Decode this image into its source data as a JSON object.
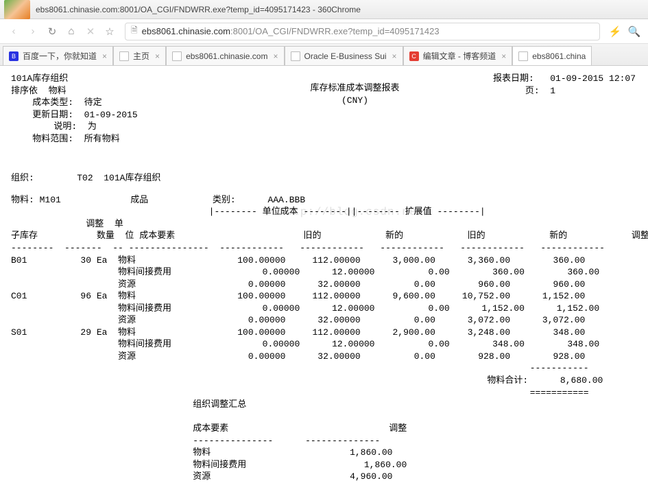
{
  "window": {
    "title": "ebs8061.chinasie.com:8001/OA_CGI/FNDWRR.exe?temp_id=4095171423 - 360Chrome"
  },
  "url": {
    "scheme_host": "ebs8061.chinasie.com",
    "port_path": ":8001/OA_CGI/FNDWRR.exe?temp_id=4095171423"
  },
  "tabs": [
    {
      "label": "百度一下，你就知道",
      "favicon": "baidu"
    },
    {
      "label": "主页",
      "favicon": "page"
    },
    {
      "label": "ebs8061.chinasie.com",
      "favicon": "page"
    },
    {
      "label": "Oracle E-Business Sui",
      "favicon": "page"
    },
    {
      "label": "编辑文章 - 博客频道",
      "favicon": "csdn"
    },
    {
      "label": "ebs8061.china",
      "favicon": "page",
      "active": true
    }
  ],
  "report": {
    "org_header": "101A库存组织",
    "sort_label": "排序依",
    "sort_value": "物料",
    "cost_type_label": "成本类型:",
    "cost_type_value": "待定",
    "update_date_label": "更新日期:",
    "update_date_value": "01-09-2015",
    "desc_label": "说明:",
    "desc_value": "为",
    "item_range_label": "物料范围:",
    "item_range_value": "所有物料",
    "title1": "库存标准成本调整报表",
    "title2": "(CNY)",
    "report_date_label": "报表日期:",
    "report_date_value": "01-09-2015 12:07",
    "page_label": "页:",
    "page_value": "1",
    "org_label": "组织:",
    "org_value": "T02  101A库存组织",
    "item_label": "物料:",
    "item_value": "M101",
    "item_desc": "成品",
    "cat_label": "类别:",
    "cat_value": "AAA.BBB",
    "watermark": "http://blog.csdn.net/",
    "hdr_adj": "调整",
    "hdr_sub": "子库存",
    "hdr_qty": "数量",
    "hdr_uom": "单\n位",
    "hdr_cost_element": "成本要素",
    "hdr_unit_cost": "单位成本",
    "hdr_ext_value": "扩展值",
    "hdr_old": "旧的",
    "hdr_new": "新的",
    "hdr_adj2": "调整",
    "total_label": "物料合计:",
    "total_value": "8,680.00",
    "rows": [
      {
        "sub": "B01",
        "qty": "30",
        "uom": "Ea",
        "elem": "物料",
        "uc_old": "100.00000",
        "uc_new": "112.00000",
        "ev_old": "3,000.00",
        "ev_new": "3,360.00",
        "adj": "360.00"
      },
      {
        "sub": "",
        "qty": "",
        "uom": "",
        "elem": "物料间接费用",
        "uc_old": "0.00000",
        "uc_new": "12.00000",
        "ev_old": "0.00",
        "ev_new": "360.00",
        "adj": "360.00"
      },
      {
        "sub": "",
        "qty": "",
        "uom": "",
        "elem": "资源",
        "uc_old": "0.00000",
        "uc_new": "32.00000",
        "ev_old": "0.00",
        "ev_new": "960.00",
        "adj": "960.00"
      },
      {
        "sub": "C01",
        "qty": "96",
        "uom": "Ea",
        "elem": "物料",
        "uc_old": "100.00000",
        "uc_new": "112.00000",
        "ev_old": "9,600.00",
        "ev_new": "10,752.00",
        "adj": "1,152.00"
      },
      {
        "sub": "",
        "qty": "",
        "uom": "",
        "elem": "物料间接费用",
        "uc_old": "0.00000",
        "uc_new": "12.00000",
        "ev_old": "0.00",
        "ev_new": "1,152.00",
        "adj": "1,152.00"
      },
      {
        "sub": "",
        "qty": "",
        "uom": "",
        "elem": "资源",
        "uc_old": "0.00000",
        "uc_new": "32.00000",
        "ev_old": "0.00",
        "ev_new": "3,072.00",
        "adj": "3,072.00"
      },
      {
        "sub": "S01",
        "qty": "29",
        "uom": "Ea",
        "elem": "物料",
        "uc_old": "100.00000",
        "uc_new": "112.00000",
        "ev_old": "2,900.00",
        "ev_new": "3,248.00",
        "adj": "348.00"
      },
      {
        "sub": "",
        "qty": "",
        "uom": "",
        "elem": "物料间接费用",
        "uc_old": "0.00000",
        "uc_new": "12.00000",
        "ev_old": "0.00",
        "ev_new": "348.00",
        "adj": "348.00"
      },
      {
        "sub": "",
        "qty": "",
        "uom": "",
        "elem": "资源",
        "uc_old": "0.00000",
        "uc_new": "32.00000",
        "ev_old": "0.00",
        "ev_new": "928.00",
        "adj": "928.00"
      }
    ],
    "summary_title": "组织调整汇总",
    "summary_hdr_elem": "成本要素",
    "summary_hdr_adj": "调整",
    "summary_rows": [
      {
        "elem": "物料",
        "adj": "1,860.00"
      },
      {
        "elem": "物料间接费用",
        "adj": "1,860.00"
      },
      {
        "elem": "资源",
        "adj": "4,960.00"
      }
    ]
  }
}
